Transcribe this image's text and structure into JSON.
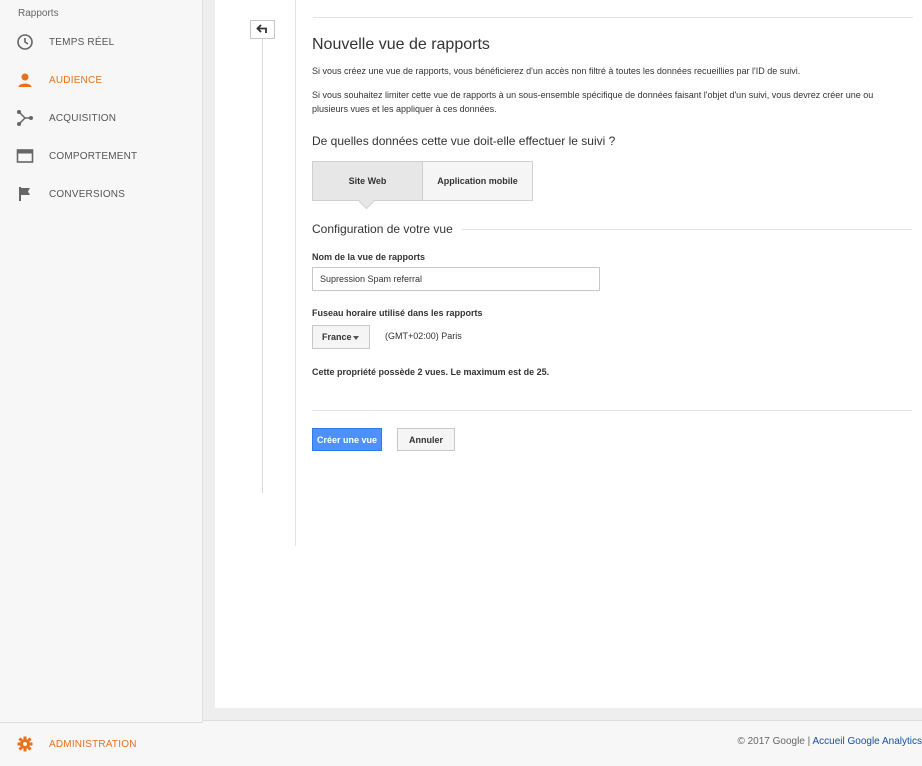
{
  "sidebar": {
    "heading": "Rapports",
    "items": [
      {
        "label": "TEMPS RÉEL",
        "icon": "clock-icon"
      },
      {
        "label": "AUDIENCE",
        "icon": "person-icon"
      },
      {
        "label": "ACQUISITION",
        "icon": "acquisition-icon"
      },
      {
        "label": "COMPORTEMENT",
        "icon": "behavior-icon"
      },
      {
        "label": "CONVERSIONS",
        "icon": "flag-icon"
      }
    ],
    "admin": {
      "label": "ADMINISTRATION",
      "icon": "gear-icon"
    }
  },
  "form": {
    "title": "Nouvelle vue de rapports",
    "intro1": "Si vous créez une vue de rapports, vous bénéficierez d'un accès non filtré à toutes les données recueillies par l'ID de suivi.",
    "intro2": "Si vous souhaitez limiter cette vue de rapports à un sous-ensemble spécifique de données faisant l'objet d'un suivi, vous devrez créer une ou plusieurs vues et les appliquer à ces données.",
    "question": "De quelles données cette vue doit-elle effectuer le suivi ?",
    "tab_web": "Site Web",
    "tab_mobile": "Application mobile",
    "section_title": "Configuration de votre vue",
    "name_label": "Nom de la vue de rapports",
    "name_value": "Supression Spam referral",
    "tz_label": "Fuseau horaire utilisé dans les rapports",
    "country": "France",
    "timezone": "(GMT+02:00) Paris",
    "note": "Cette propriété possède 2 vues. Le maximum est de 25.",
    "create_label": "Créer une vue",
    "cancel_label": "Annuler"
  },
  "footer": {
    "copyright": "© 2017 Google | ",
    "link": "Accueil Google Analytics"
  },
  "colors": {
    "accent": "#e8711c",
    "primary_button": "#4d90fe"
  }
}
